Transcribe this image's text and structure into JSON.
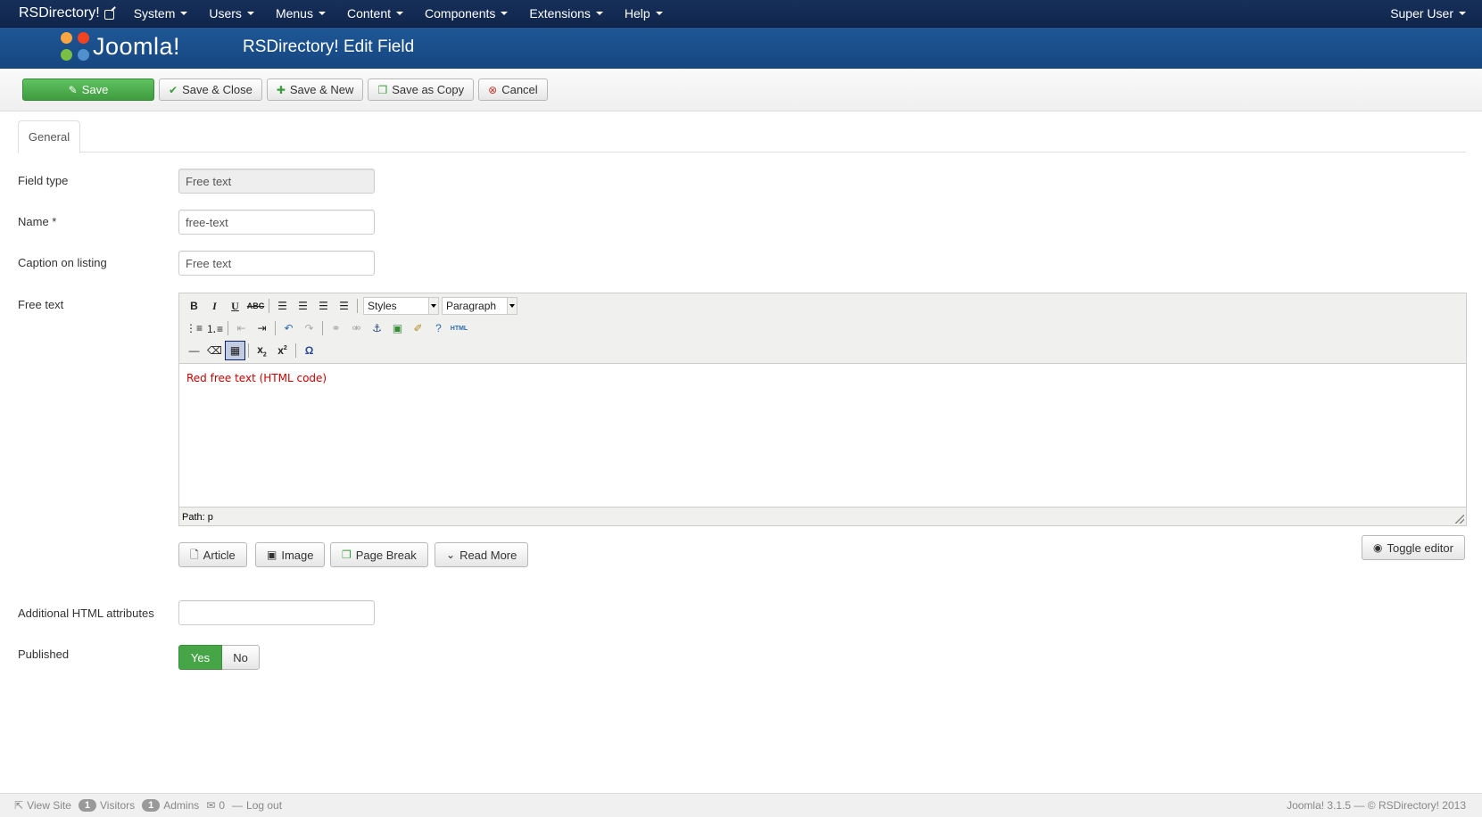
{
  "navbar": {
    "brand": "RSDirectory!",
    "menu": [
      "System",
      "Users",
      "Menus",
      "Content",
      "Components",
      "Extensions",
      "Help"
    ],
    "user": "Super User"
  },
  "header": {
    "logo_text": "Joomla!",
    "title": "RSDirectory! Edit Field"
  },
  "toolbar": {
    "save": "Save",
    "save_close": "Save & Close",
    "save_new": "Save & New",
    "save_copy": "Save as Copy",
    "cancel": "Cancel"
  },
  "tabs": [
    "General"
  ],
  "form": {
    "field_type_label": "Field type",
    "field_type_value": "Free text",
    "name_label": "Name *",
    "name_value": "free-text",
    "caption_label": "Caption on listing",
    "caption_value": "Free text",
    "free_text_label": "Free text",
    "additional_label": "Additional HTML attributes",
    "additional_value": "",
    "published_label": "Published",
    "published_yes": "Yes",
    "published_no": "No"
  },
  "editor": {
    "styles_select": "Styles",
    "format_select": "Paragraph",
    "content": "Red free text (HTML code)",
    "content_color": "#cc0000",
    "path": "Path: p",
    "html_label": "HTML"
  },
  "editor_buttons": {
    "article": "Article",
    "image": "Image",
    "page_break": "Page Break",
    "read_more": "Read More",
    "toggle": "Toggle editor"
  },
  "footer": {
    "view_site": "View Site",
    "visitors_count": "1",
    "visitors": "Visitors",
    "admins_count": "1",
    "admins": "Admins",
    "messages_count": "0",
    "logout": "Log out",
    "version": "Joomla! 3.1.5  —  © RSDirectory! 2013"
  },
  "colors": {
    "navbar": "#10254b",
    "header": "#1e5796",
    "save": "#46a546"
  }
}
